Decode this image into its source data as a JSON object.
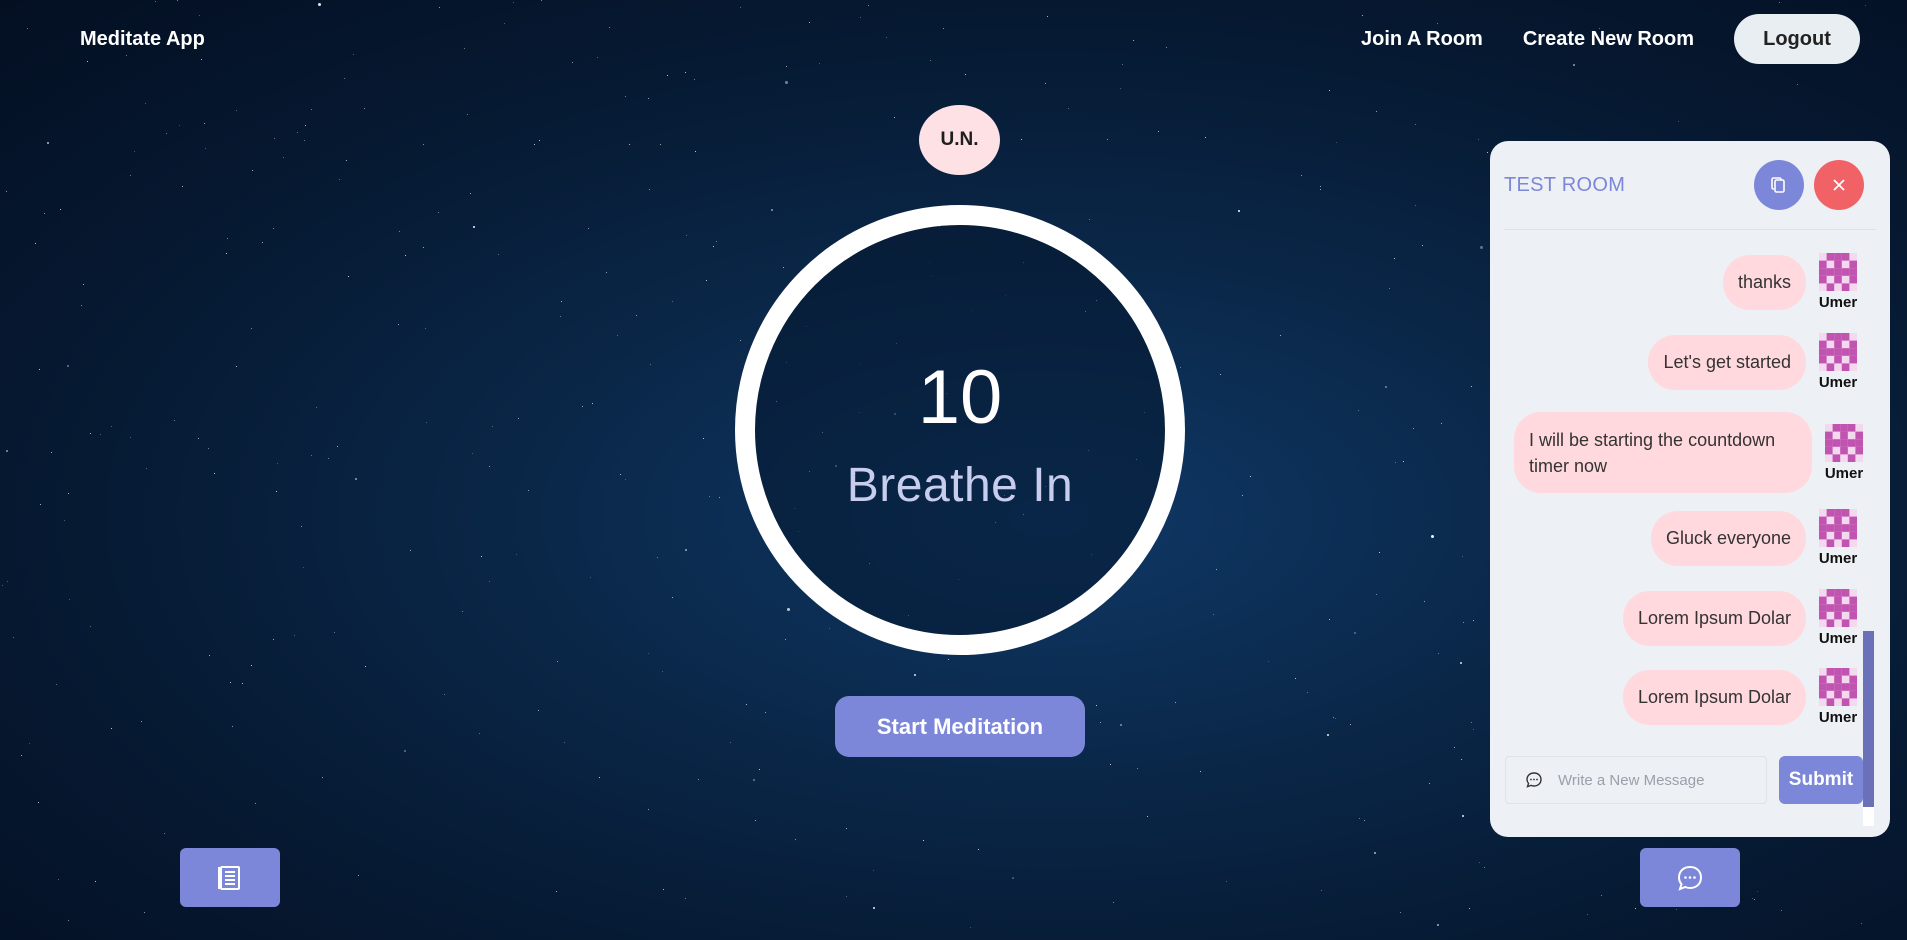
{
  "navbar": {
    "brand": "Meditate App",
    "links": [
      "Join A Room",
      "Create New Room"
    ],
    "logout_label": "Logout"
  },
  "user_badge": "U.N.",
  "timer": {
    "count": "10",
    "phase": "Breathe In"
  },
  "start_button_label": "Start Meditation",
  "bottom_left_icon": "book-icon",
  "bottom_right_icon": "chat-bubble-icon",
  "chat": {
    "room_title": "TEST ROOM",
    "header_icons": [
      "copy-icon",
      "close-icon"
    ],
    "messages": [
      {
        "text": "thanks",
        "author": "Umer"
      },
      {
        "text": "Let's get started",
        "author": "Umer"
      },
      {
        "text": "I will be starting the countdown timer now",
        "author": "Umer"
      },
      {
        "text": "Gluck everyone",
        "author": "Umer"
      },
      {
        "text": "Lorem Ipsum Dolar",
        "author": "Umer"
      },
      {
        "text": "Lorem Ipsum Dolar",
        "author": "Umer"
      }
    ],
    "input_placeholder": "Write a New Message",
    "submit_label": "Submit"
  },
  "colors": {
    "accent": "#7c87d9",
    "bubble": "#ffd9dd",
    "close": "#f06266",
    "avatar": "#c154b0"
  }
}
